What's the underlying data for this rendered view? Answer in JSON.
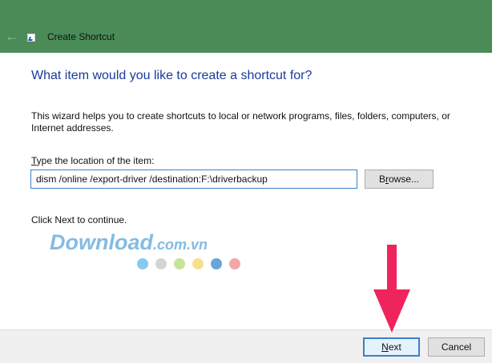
{
  "window": {
    "title": "Create Shortcut",
    "back_icon": "back-arrow-icon",
    "app_icon": "shortcut-icon"
  },
  "main": {
    "heading": "What item would you like to create a shortcut for?",
    "description": "This wizard helps you to create shortcuts to local or network programs, files, folders, computers, or Internet addresses.",
    "location_label_mnemonic": "T",
    "location_label_rest": "ype the location of the item:",
    "location_value": "dism /online /export-driver /destination:F:\\driverbackup",
    "browse_mnemonic_pre": "B",
    "browse_mnemonic": "r",
    "browse_rest": "owse...",
    "continue_text": "Click Next to continue."
  },
  "watermark": {
    "text": "Download",
    "suffix": ".com.vn",
    "dot_colors": [
      "#87c9ef",
      "#d4d4d4",
      "#c5e49a",
      "#f6e08c",
      "#6aa5d8",
      "#f2a7a7"
    ]
  },
  "footer": {
    "next_mnemonic": "N",
    "next_rest": "ext",
    "cancel_label": "Cancel"
  },
  "colors": {
    "titlebar": "#4a8b58",
    "heading": "#1a3a9b",
    "arrow": "#f0245d"
  }
}
